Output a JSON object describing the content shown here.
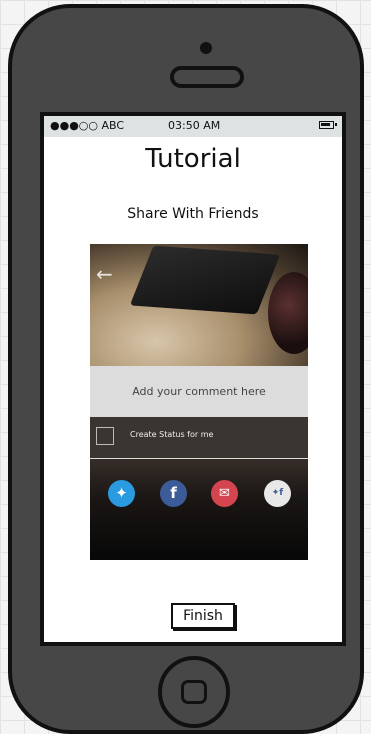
{
  "status_bar": {
    "carrier": "●●●○○ ABC",
    "time": "03:50 AM"
  },
  "screen": {
    "title": "Tutorial",
    "subtitle": "Share With Friends"
  },
  "share_card": {
    "comment_placeholder": "Add your comment here",
    "status_checkbox_label": "Create Status for me",
    "share_icons": [
      "twitter-icon",
      "facebook-icon",
      "email-icon",
      "social-more-icon"
    ]
  },
  "finish_button": {
    "label": "Finish"
  },
  "colors": {
    "twitter": "#2a9be0",
    "facebook": "#3c5b99",
    "email": "#d4454f",
    "phone_body": "#474747",
    "status_bar": "#dde3e3"
  }
}
